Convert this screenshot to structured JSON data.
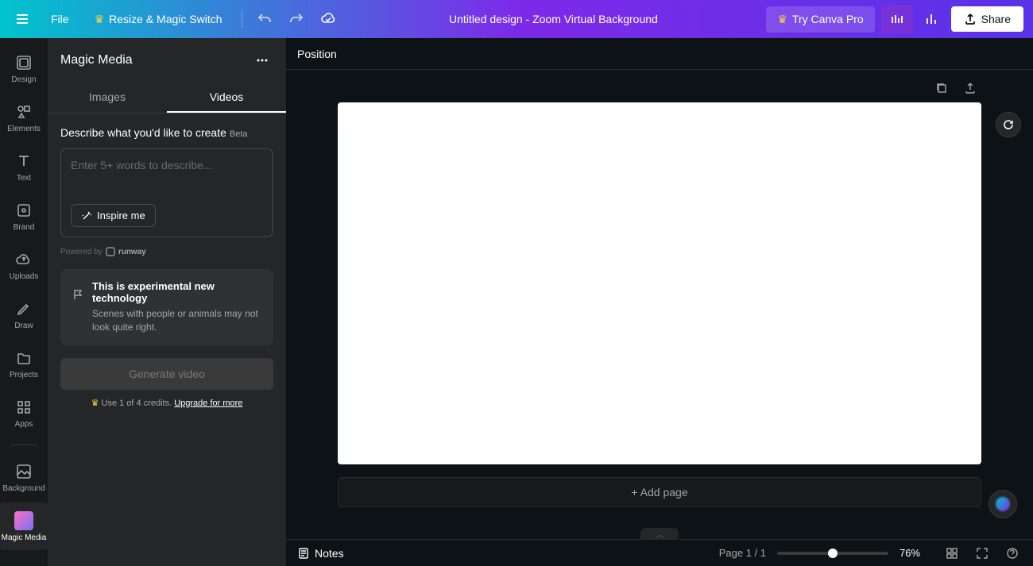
{
  "topbar": {
    "file_label": "File",
    "resize_label": "Resize & Magic Switch",
    "doc_title": "Untitled design - Zoom Virtual Background",
    "try_pro_label": "Try Canva Pro",
    "share_label": "Share"
  },
  "rail": {
    "items": [
      {
        "label": "Design",
        "icon": "design"
      },
      {
        "label": "Elements",
        "icon": "elements"
      },
      {
        "label": "Text",
        "icon": "text"
      },
      {
        "label": "Brand",
        "icon": "brand"
      },
      {
        "label": "Uploads",
        "icon": "uploads"
      },
      {
        "label": "Draw",
        "icon": "draw"
      },
      {
        "label": "Projects",
        "icon": "projects"
      },
      {
        "label": "Apps",
        "icon": "apps"
      },
      {
        "label": "Background",
        "icon": "background"
      },
      {
        "label": "Magic Media",
        "icon": "magicmedia"
      }
    ]
  },
  "panel": {
    "title": "Magic Media",
    "tabs": {
      "images": "Images",
      "videos": "Videos"
    },
    "describe_label": "Describe what you'd like to create",
    "beta": "Beta",
    "placeholder": "Enter 5+ words to describe...",
    "inspire": "Inspire me",
    "powered_by": "Powered by",
    "runway": "runway",
    "info_title": "This is experimental new technology",
    "info_text": "Scenes with people or animals may not look quite right.",
    "generate": "Generate video",
    "credits_prefix": "Use 1 of 4 credits. ",
    "credits_link": "Upgrade for more"
  },
  "canvas": {
    "position_label": "Position",
    "add_page": "+ Add page"
  },
  "bottombar": {
    "notes": "Notes",
    "page_indicator": "Page 1 / 1",
    "zoom_pct": "76%"
  }
}
